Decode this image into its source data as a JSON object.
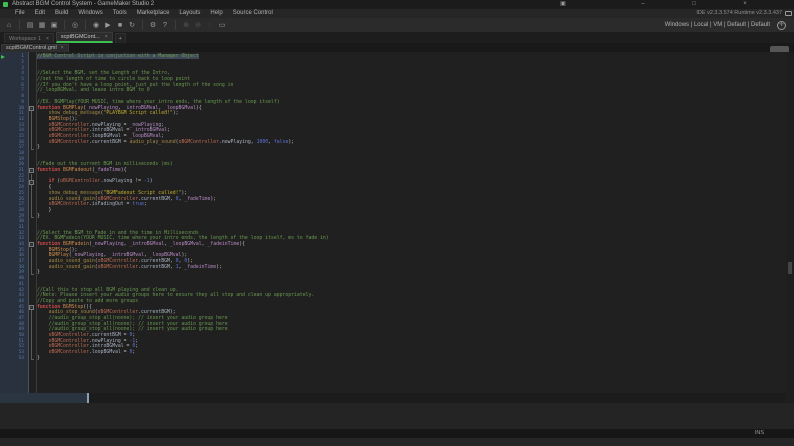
{
  "window": {
    "title": "Abstract BGM Control System - GameMaker Studio 2",
    "layout_icon_glyph": "▣",
    "minimize_glyph": "–",
    "maximize_glyph": "□",
    "close_glyph": "×"
  },
  "menu": {
    "items": [
      "File",
      "Edit",
      "Build",
      "Windows",
      "Tools",
      "Marketplace",
      "Layouts",
      "Help",
      "Source Control"
    ]
  },
  "info_bar": {
    "version_text": "IDE v2.3.3.574  Runtime v2.3.3.437"
  },
  "toolbar": {
    "buttons": [
      {
        "name": "home-button",
        "glyph": "⌂"
      },
      {
        "name": "separator"
      },
      {
        "name": "new-project-button",
        "glyph": "▤"
      },
      {
        "name": "open-project-button",
        "glyph": "▦"
      },
      {
        "name": "save-project-button",
        "glyph": "▣"
      },
      {
        "name": "separator"
      },
      {
        "name": "create-executable-button",
        "glyph": "◎"
      },
      {
        "name": "separator"
      },
      {
        "name": "debug-button",
        "glyph": "◉"
      },
      {
        "name": "run-button",
        "glyph": "▶"
      },
      {
        "name": "stop-button",
        "glyph": "■"
      },
      {
        "name": "clean-button",
        "glyph": "↻"
      },
      {
        "name": "separator"
      },
      {
        "name": "game-options-button",
        "glyph": "⚙"
      },
      {
        "name": "help-button",
        "glyph": "?"
      },
      {
        "name": "separator"
      },
      {
        "name": "zoom-in-button",
        "glyph": "⊕",
        "disabled": true
      },
      {
        "name": "zoom-out-button",
        "glyph": "⊖",
        "disabled": true
      },
      {
        "name": "zoom-reset-button",
        "glyph": "◌",
        "disabled": true
      },
      {
        "name": "laptop-mode-button",
        "glyph": "▭"
      }
    ],
    "target_text": "Windows | Local | VM | Default | Default",
    "target_icon_glyph": "✛"
  },
  "workspace_tabs": {
    "tabs": [
      {
        "label": "Workspace 1",
        "active": false
      },
      {
        "label": "scptBGMCont...",
        "active": true
      }
    ],
    "add_label": "+",
    "close_glyph": "×"
  },
  "document_tabs": {
    "tabs": [
      {
        "label": "scptBGMControl.gml"
      }
    ],
    "close_glyph": "×"
  },
  "editor": {
    "selected_line": 1,
    "current_line_marker": 1,
    "fold_boxes": [
      10,
      21,
      23,
      34,
      45
    ],
    "fold_ranges": [
      [
        10,
        17
      ],
      [
        21,
        29
      ],
      [
        34,
        39
      ],
      [
        45,
        54
      ]
    ],
    "lines": [
      [
        [
          "cm",
          "//BGM Control Script in conjuction with a Manager Object"
        ]
      ],
      [],
      [],
      [
        [
          "cm",
          "//Select the BGM, set the Length of the Intro,"
        ]
      ],
      [
        [
          "cm",
          "//set the length of time to circle back to loop point"
        ]
      ],
      [
        [
          "cm",
          "//If you don't have a loop point, just put the length of the song in"
        ]
      ],
      [
        [
          "cm",
          "//_loopBGMval, and leave intro BGM to 0"
        ]
      ],
      [],
      [
        [
          "cm",
          "//EX. BGMPlay(YOUR MUSIC, time where your intro ends, the length of the loop itself)"
        ]
      ],
      [
        [
          "kw",
          "function "
        ],
        [
          "fn",
          "BGMPlay"
        ],
        [
          "pl",
          "("
        ],
        [
          "lv",
          "_nowPlaying"
        ],
        [
          "pl",
          ", "
        ],
        [
          "lv",
          "_introBGMval"
        ],
        [
          "pl",
          ", "
        ],
        [
          "lv",
          "_loopBGMval"
        ],
        [
          "pl",
          "){"
        ]
      ],
      [
        [
          "pl",
          "    "
        ],
        [
          "bi",
          "show_debug_message"
        ],
        [
          "pl",
          "("
        ],
        [
          "st",
          "\"PLAYBGM Script called!\""
        ],
        [
          "pl",
          ");"
        ]
      ],
      [
        [
          "pl",
          "    "
        ],
        [
          "fn",
          "BGMStop"
        ],
        [
          "pl",
          "();"
        ]
      ],
      [
        [
          "pl",
          "    "
        ],
        [
          "ob",
          "oBGMController"
        ],
        [
          "pl",
          "."
        ],
        [
          "pr",
          "nowPlaying"
        ],
        [
          "pl",
          " = "
        ],
        [
          "lv",
          "_nowPlaying"
        ],
        [
          "pl",
          ";"
        ]
      ],
      [
        [
          "pl",
          "    "
        ],
        [
          "ob",
          "oBGMController"
        ],
        [
          "pl",
          "."
        ],
        [
          "pr",
          "introBGMval"
        ],
        [
          "pl",
          " = "
        ],
        [
          "lv",
          "_introBGMval"
        ],
        [
          "pl",
          ";"
        ]
      ],
      [
        [
          "pl",
          "    "
        ],
        [
          "ob",
          "oBGMController"
        ],
        [
          "pl",
          "."
        ],
        [
          "pr",
          "loopBGMval"
        ],
        [
          "pl",
          " = "
        ],
        [
          "lv",
          "_loopBGMval"
        ],
        [
          "pl",
          ";"
        ]
      ],
      [
        [
          "pl",
          "    "
        ],
        [
          "ob",
          "oBGMController"
        ],
        [
          "pl",
          "."
        ],
        [
          "pr",
          "currentBGM"
        ],
        [
          "pl",
          " = "
        ],
        [
          "bi",
          "audio_play_sound"
        ],
        [
          "pl",
          "("
        ],
        [
          "ob",
          "oBGMController"
        ],
        [
          "pl",
          "."
        ],
        [
          "pr",
          "nowPlaying"
        ],
        [
          "pl",
          ", "
        ],
        [
          "nm",
          "1000"
        ],
        [
          "pl",
          ", "
        ],
        [
          "nm",
          "false"
        ],
        [
          "pl",
          ");"
        ]
      ],
      [
        [
          "pl",
          "}"
        ]
      ],
      [],
      [],
      [
        [
          "cm",
          "//Fade out the current BGM in milliseconds (ms)"
        ]
      ],
      [
        [
          "kw",
          "function "
        ],
        [
          "fn",
          "BGMFadeout"
        ],
        [
          "pl",
          "("
        ],
        [
          "lv",
          "_fadeTime"
        ],
        [
          "pl",
          "){"
        ]
      ],
      [],
      [
        [
          "pl",
          "    "
        ],
        [
          "kw",
          "if"
        ],
        [
          "pl",
          " ("
        ],
        [
          "ob",
          "oBGMController"
        ],
        [
          "pl",
          "."
        ],
        [
          "pr",
          "nowPlaying"
        ],
        [
          "pl",
          " != "
        ],
        [
          "nm",
          "-1"
        ],
        [
          "pl",
          ")"
        ]
      ],
      [
        [
          "pl",
          "    {"
        ]
      ],
      [
        [
          "pl",
          "    "
        ],
        [
          "bi",
          "show_debug_message"
        ],
        [
          "pl",
          "("
        ],
        [
          "st",
          "\"BGMFadeout Script called!\""
        ],
        [
          "pl",
          ");"
        ]
      ],
      [
        [
          "pl",
          "    "
        ],
        [
          "bi",
          "audio_sound_gain"
        ],
        [
          "pl",
          "("
        ],
        [
          "ob",
          "oBGMController"
        ],
        [
          "pl",
          "."
        ],
        [
          "pr",
          "currentBGM"
        ],
        [
          "pl",
          ", "
        ],
        [
          "nm",
          "0"
        ],
        [
          "pl",
          ", "
        ],
        [
          "lv",
          "_fadeTime"
        ],
        [
          "pl",
          ");"
        ]
      ],
      [
        [
          "pl",
          "    "
        ],
        [
          "ob",
          "oBGMController"
        ],
        [
          "pl",
          "."
        ],
        [
          "pr",
          "isFadingOut"
        ],
        [
          "pl",
          " = "
        ],
        [
          "nm",
          "true"
        ],
        [
          "pl",
          ";"
        ]
      ],
      [
        [
          "pl",
          "    }"
        ]
      ],
      [
        [
          "pl",
          "}"
        ]
      ],
      [],
      [],
      [
        [
          "cm",
          "//Select the BGM to Fade in and the time in Milliseconds"
        ]
      ],
      [
        [
          "cm",
          "//EX. BGMFadein(YOUR MUSIC, time where your intro ends, the length of the loop itself, ms to fade in)"
        ]
      ],
      [
        [
          "kw",
          "function "
        ],
        [
          "fn",
          "BGMFadein"
        ],
        [
          "pl",
          "("
        ],
        [
          "lv",
          "_nowPlaying"
        ],
        [
          "pl",
          ", "
        ],
        [
          "lv",
          "_introBGMval"
        ],
        [
          "pl",
          ", "
        ],
        [
          "lv",
          "_loopBGMval"
        ],
        [
          "pl",
          ", "
        ],
        [
          "lv",
          "_fadeinTime"
        ],
        [
          "pl",
          "){"
        ]
      ],
      [
        [
          "pl",
          "    "
        ],
        [
          "fn",
          "BGMStop"
        ],
        [
          "pl",
          "();"
        ]
      ],
      [
        [
          "pl",
          "    "
        ],
        [
          "fn",
          "BGMPlay"
        ],
        [
          "pl",
          "("
        ],
        [
          "lv",
          "_nowPlaying"
        ],
        [
          "pl",
          ", "
        ],
        [
          "lv",
          "_introBGMval"
        ],
        [
          "pl",
          ", "
        ],
        [
          "lv",
          "_loopBGMval"
        ],
        [
          "pl",
          ");"
        ]
      ],
      [
        [
          "pl",
          "    "
        ],
        [
          "bi",
          "audio_sound_gain"
        ],
        [
          "pl",
          "("
        ],
        [
          "ob",
          "oBGMController"
        ],
        [
          "pl",
          "."
        ],
        [
          "pr",
          "currentBGM"
        ],
        [
          "pl",
          ", "
        ],
        [
          "nm",
          "0"
        ],
        [
          "pl",
          ", "
        ],
        [
          "nm",
          "0"
        ],
        [
          "pl",
          ");"
        ]
      ],
      [
        [
          "pl",
          "    "
        ],
        [
          "bi",
          "audio_sound_gain"
        ],
        [
          "pl",
          "("
        ],
        [
          "ob",
          "oBGMController"
        ],
        [
          "pl",
          "."
        ],
        [
          "pr",
          "currentBGM"
        ],
        [
          "pl",
          ", "
        ],
        [
          "nm",
          "1"
        ],
        [
          "pl",
          ", "
        ],
        [
          "lv",
          "_fadeinTime"
        ],
        [
          "pl",
          ");"
        ]
      ],
      [
        [
          "pl",
          "}"
        ]
      ],
      [],
      [],
      [
        [
          "cm",
          "//Call this to stop all BGM playing and clean up."
        ]
      ],
      [
        [
          "cm",
          "//Note: Please insert your audio groups here to ensure they all stop and clean up appropriately."
        ]
      ],
      [
        [
          "cm",
          "//Copy and paste to add more groups"
        ]
      ],
      [
        [
          "kw",
          "function "
        ],
        [
          "fn",
          "BGMStop"
        ],
        [
          "pl",
          "(){"
        ]
      ],
      [
        [
          "pl",
          "    "
        ],
        [
          "bi",
          "audio_stop_sound"
        ],
        [
          "pl",
          "("
        ],
        [
          "ob",
          "oBGMController"
        ],
        [
          "pl",
          "."
        ],
        [
          "pr",
          "currentBGM"
        ],
        [
          "pl",
          ");"
        ]
      ],
      [
        [
          "pl",
          "    "
        ],
        [
          "cm",
          "//audio_group_stop_all(noone); // insert your audio group here"
        ]
      ],
      [
        [
          "pl",
          "    "
        ],
        [
          "cm",
          "//audio_group_stop_all(noone); // insert your audio group here"
        ]
      ],
      [
        [
          "pl",
          "    "
        ],
        [
          "cm",
          "//audio_group_stop_all(noone); // insert your audio group here"
        ]
      ],
      [
        [
          "pl",
          "    "
        ],
        [
          "ob",
          "oBGMController"
        ],
        [
          "pl",
          "."
        ],
        [
          "pr",
          "currentBGM"
        ],
        [
          "pl",
          " = "
        ],
        [
          "nm",
          "0"
        ],
        [
          "pl",
          ";"
        ]
      ],
      [
        [
          "pl",
          "    "
        ],
        [
          "ob",
          "oBGMController"
        ],
        [
          "pl",
          "."
        ],
        [
          "pr",
          "nowPlaying"
        ],
        [
          "pl",
          " = "
        ],
        [
          "nm",
          "-1"
        ],
        [
          "pl",
          ";"
        ]
      ],
      [
        [
          "pl",
          "    "
        ],
        [
          "ob",
          "oBGMController"
        ],
        [
          "pl",
          "."
        ],
        [
          "pr",
          "introBGMval"
        ],
        [
          "pl",
          " = "
        ],
        [
          "nm",
          "0"
        ],
        [
          "pl",
          ";"
        ]
      ],
      [
        [
          "pl",
          "    "
        ],
        [
          "ob",
          "oBGMController"
        ],
        [
          "pl",
          "."
        ],
        [
          "pr",
          "loopBGMval"
        ],
        [
          "pl",
          " = "
        ],
        [
          "nm",
          "0"
        ],
        [
          "pl",
          ";"
        ]
      ],
      [
        [
          "pl",
          "}"
        ]
      ]
    ]
  },
  "status_bar": {
    "insert_mode": "INS"
  },
  "colors": {
    "accent_green": "#3cbe50",
    "editor_bg": "#202020",
    "gutter_bg": "#28313d",
    "selection_bg": "#3d4757",
    "comment": "#699a4f",
    "keyword": "#ce4b4b",
    "string": "#c3ad2b",
    "number": "#5f74d8"
  }
}
